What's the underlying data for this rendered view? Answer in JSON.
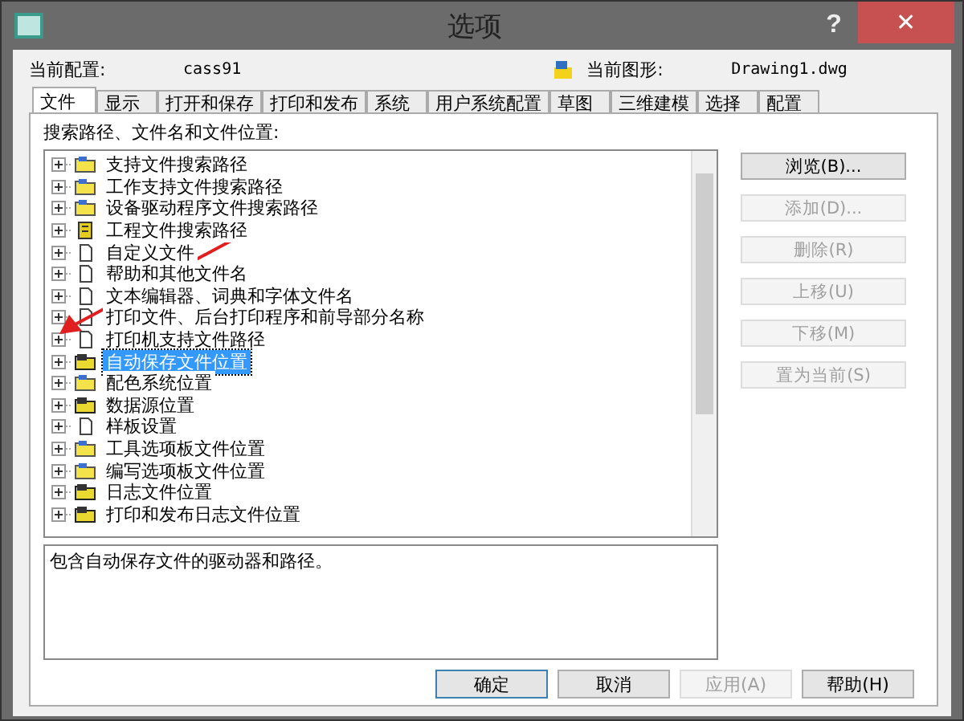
{
  "window": {
    "title": "选项",
    "help": "?",
    "close": "✕"
  },
  "profile": {
    "label": "当前配置:",
    "value": "cass91"
  },
  "drawing": {
    "label": "当前图形:",
    "value": "Drawing1.dwg"
  },
  "tabs": [
    {
      "label": "文件",
      "selected": true
    },
    {
      "label": "显示",
      "selected": false
    },
    {
      "label": "打开和保存",
      "selected": false
    },
    {
      "label": "打印和发布",
      "selected": false
    },
    {
      "label": "系统",
      "selected": false
    },
    {
      "label": "用户系统配置",
      "selected": false
    },
    {
      "label": "草图",
      "selected": false
    },
    {
      "label": "三维建模",
      "selected": false
    },
    {
      "label": "选择",
      "selected": false
    },
    {
      "label": "配置",
      "selected": false
    }
  ],
  "tree": {
    "heading": "搜索路径、文件名和文件位置:",
    "items": [
      {
        "label": "支持文件搜索路径",
        "kind": "folder",
        "selected": false
      },
      {
        "label": "工作支持文件搜索路径",
        "kind": "folder",
        "selected": false
      },
      {
        "label": "设备驱动程序文件搜索路径",
        "kind": "folder",
        "selected": false
      },
      {
        "label": "工程文件搜索路径",
        "kind": "project",
        "selected": false
      },
      {
        "label": "自定义文件",
        "kind": "file",
        "selected": false
      },
      {
        "label": "帮助和其他文件名",
        "kind": "file",
        "selected": false
      },
      {
        "label": "文本编辑器、词典和字体文件名",
        "kind": "file",
        "selected": false
      },
      {
        "label": "打印文件、后台打印程序和前导部分名称",
        "kind": "file",
        "selected": false
      },
      {
        "label": "打印机支持文件路径",
        "kind": "file",
        "selected": false
      },
      {
        "label": "自动保存文件位置",
        "kind": "darkfolder",
        "selected": true
      },
      {
        "label": "配色系统位置",
        "kind": "folder",
        "selected": false
      },
      {
        "label": "数据源位置",
        "kind": "darkfolder",
        "selected": false
      },
      {
        "label": "样板设置",
        "kind": "file",
        "selected": false
      },
      {
        "label": "工具选项板文件位置",
        "kind": "folder",
        "selected": false
      },
      {
        "label": "编写选项板文件位置",
        "kind": "folder",
        "selected": false
      },
      {
        "label": "日志文件位置",
        "kind": "darkfolder",
        "selected": false
      },
      {
        "label": "打印和发布日志文件位置",
        "kind": "darkfolder",
        "selected": false
      }
    ]
  },
  "description": "包含自动保存文件的驱动器和路径。",
  "side_buttons": [
    {
      "label": "浏览(B)...",
      "disabled": false
    },
    {
      "label": "添加(D)...",
      "disabled": true
    },
    {
      "label": "删除(R)",
      "disabled": true
    },
    {
      "label": "上移(U)",
      "disabled": true
    },
    {
      "label": "下移(M)",
      "disabled": true
    },
    {
      "label": "置为当前(S)",
      "disabled": true
    }
  ],
  "footer_buttons": [
    {
      "label": "确定",
      "disabled": false,
      "default": true
    },
    {
      "label": "取消",
      "disabled": false,
      "default": false
    },
    {
      "label": "应用(A)",
      "disabled": true,
      "default": false
    },
    {
      "label": "帮助(H)",
      "disabled": false,
      "default": false
    }
  ]
}
